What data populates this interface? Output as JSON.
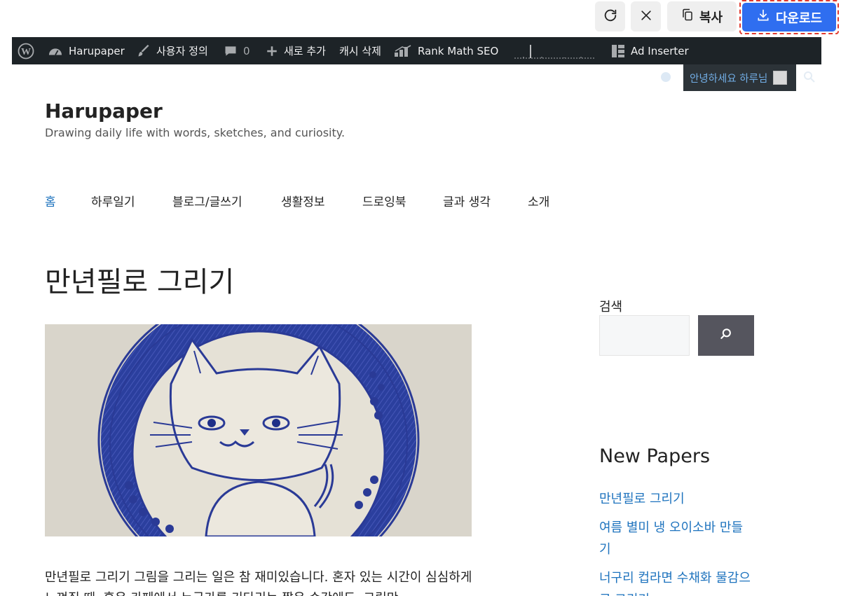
{
  "toolbar": {
    "refresh_icon": "refresh-icon",
    "close_icon": "close-icon",
    "copy_icon": "copy-icon",
    "copy_label": "복사",
    "download_icon": "download-icon",
    "download_label": "다운로드",
    "accent_color": "#2f6ef0",
    "highlight_color": "#e0382e"
  },
  "admin_bar": {
    "wp_icon": "wordpress-icon",
    "site_name": "Harupaper",
    "customize": "사용자 정의",
    "comments_count": "0",
    "new_content": "새로 추가",
    "clear_cache": "캐시 삭제",
    "rank_math": "Rank Math SEO",
    "ad_inserter": "Ad Inserter",
    "greeting": "안녕하세요 하루님",
    "background_color": "#1d2327"
  },
  "site": {
    "title": "Harupaper",
    "tagline": "Drawing daily life with words, sketches, and curiosity."
  },
  "nav": {
    "items": [
      "홈",
      "하루일기",
      "블로그/글쓰기",
      "생활정보",
      "드로잉북",
      "글과 생각",
      "소개"
    ],
    "active_color": "#1e73be"
  },
  "post": {
    "title": "만년필로 그리기",
    "image": "blue-ink-cat-drawing",
    "body": "만년필로 그리기 그림을 그리는 일은 참 재미있습니다. 혼자 있는 시간이 심심하게 느껴질 때, 혹은 카페에서 누군가를 기다리는 짧은 순간에도, 그림만"
  },
  "sidebar": {
    "search_label": "검색",
    "search_icon": "search-icon",
    "new_papers_title": "New Papers",
    "new_papers": [
      "만년필로 그리기",
      "여름 별미 냉 오이소바 만들기",
      "너구리 컵라면 수채화 물감으로 그리기"
    ],
    "link_color": "#1e73be"
  }
}
